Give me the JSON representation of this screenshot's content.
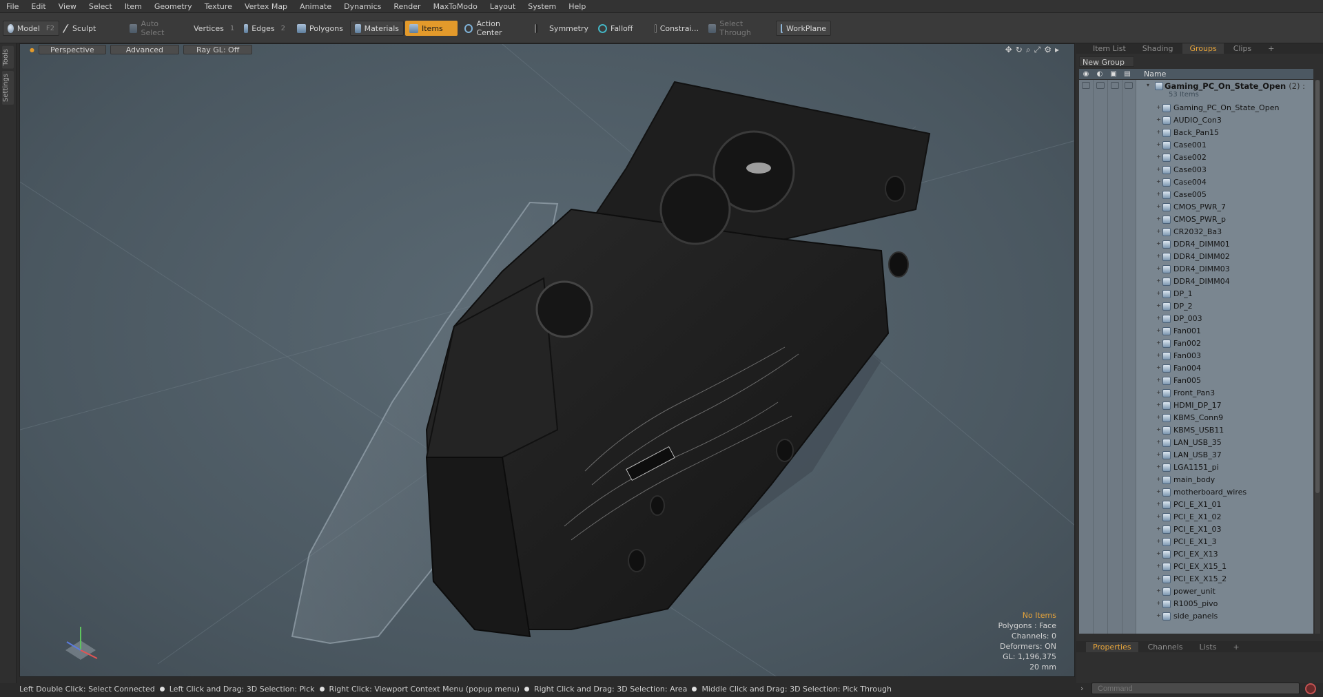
{
  "menu": [
    "File",
    "Edit",
    "View",
    "Select",
    "Item",
    "Geometry",
    "Texture",
    "Vertex Map",
    "Animate",
    "Dynamics",
    "Render",
    "MaxToModo",
    "Layout",
    "System",
    "Help"
  ],
  "toolbar": {
    "model": "Model",
    "model_key": "F2",
    "sculpt": "Sculpt",
    "auto_select": "Auto Select",
    "vertices": "Vertices",
    "vertices_key": "1",
    "edges": "Edges",
    "edges_key": "2",
    "polygons": "Polygons",
    "materials": "Materials",
    "items": "Items",
    "action_center": "Action Center",
    "symmetry": "Symmetry",
    "falloff": "Falloff",
    "constraints": "Constrai...",
    "select_through": "Select Through",
    "workplane": "WorkPlane"
  },
  "left_tabs": [
    "Tools",
    "Settings"
  ],
  "viewport": {
    "view_mode": "Perspective",
    "shading": "Advanced",
    "ray_gl": "Ray GL: Off",
    "info": {
      "selection": "No Items",
      "polygons": "Polygons : Face",
      "channels": "Channels: 0",
      "deformers": "Deformers: ON",
      "gl": "GL: 1,196,375",
      "scale": "20 mm"
    }
  },
  "right_panel": {
    "tabs": [
      "Item List",
      "Shading",
      "Groups",
      "Clips",
      "+"
    ],
    "active_tab": "Groups",
    "new_group": "New Group",
    "column_name": "Name",
    "root_group": "Gaming_PC_On_State_Open",
    "root_count": "(2) :",
    "root_items": "53 Items",
    "items": [
      "Gaming_PC_On_State_Open",
      "AUDIO_Con3",
      "Back_Pan15",
      "Case001",
      "Case002",
      "Case003",
      "Case004",
      "Case005",
      "CMOS_PWR_7",
      "CMOS_PWR_p",
      "CR2032_Ba3",
      "DDR4_DIMM01",
      "DDR4_DIMM02",
      "DDR4_DIMM03",
      "DDR4_DIMM04",
      "DP_1",
      "DP_2",
      "DP_003",
      "Fan001",
      "Fan002",
      "Fan003",
      "Fan004",
      "Fan005",
      "Front_Pan3",
      "HDMI_DP_17",
      "KBMS_Conn9",
      "KBMS_USB11",
      "LAN_USB_35",
      "LAN_USB_37",
      "LGA1151_pi",
      "main_body",
      "motherboard_wires",
      "PCI_E_X1_01",
      "PCI_E_X1_02",
      "PCI_E_X1_03",
      "PCI_E_X1_3",
      "PCI_EX_X13",
      "PCI_EX_X15_1",
      "PCI_EX_X15_2",
      "power_unit",
      "R1005_pivo",
      "side_panels"
    ],
    "bottom_tabs": [
      "Properties",
      "Channels",
      "Lists",
      "+"
    ],
    "active_bottom_tab": "Properties"
  },
  "command": {
    "placeholder": "Command"
  },
  "status": [
    "Left Double Click: Select Connected",
    "Left Click and Drag: 3D Selection: Pick",
    "Right Click: Viewport Context Menu (popup menu)",
    "Right Click and Drag: 3D Selection: Area",
    "Middle Click and Drag: 3D Selection: Pick Through"
  ],
  "colors": {
    "accent": "#e39a2b",
    "viewport_bg": "#55636c",
    "group_list_bg": "#7a8690"
  }
}
